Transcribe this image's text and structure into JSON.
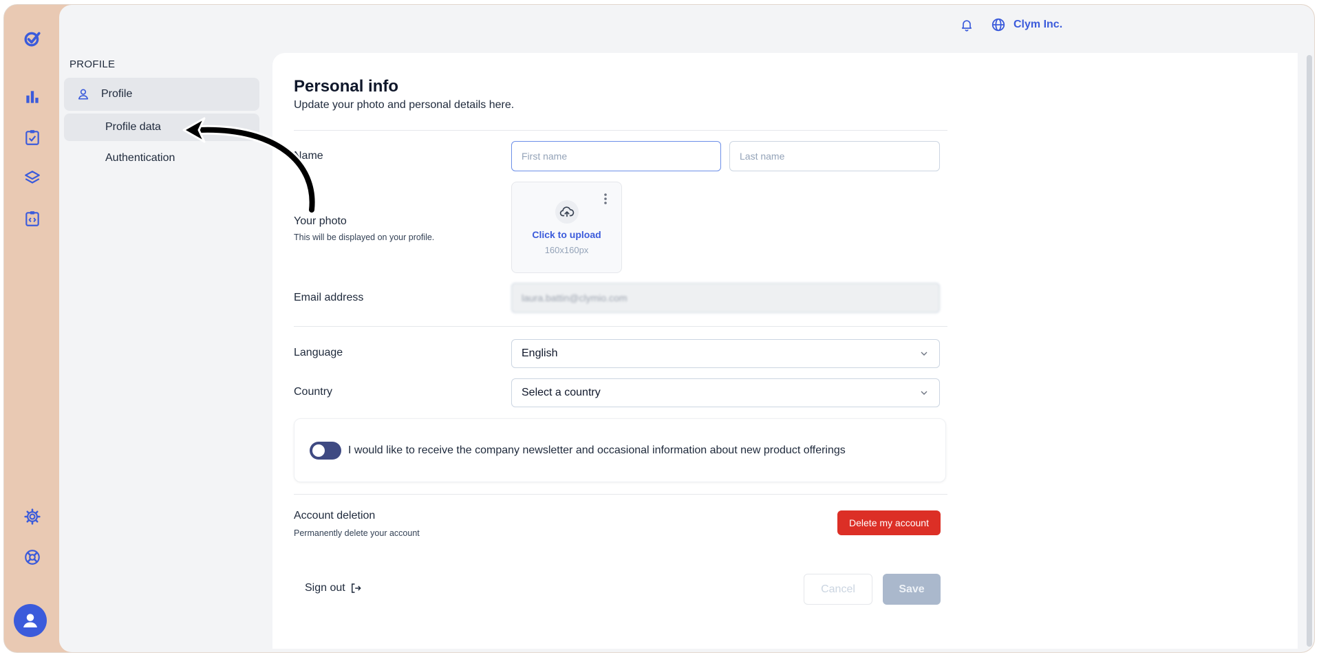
{
  "org": {
    "name": "Clym Inc."
  },
  "colors": {
    "accent": "#3b5bdb",
    "danger": "#dc2f26",
    "rail_bg": "#e9c9b3"
  },
  "rail": {
    "icons": [
      "logo-check-icon",
      "bar-chart-icon",
      "clipboard-check-icon",
      "layers-icon",
      "clipboard-code-icon",
      "gear-icon",
      "life-buoy-icon",
      "user-avatar-icon"
    ]
  },
  "sidebar": {
    "section_title": "PROFILE",
    "items": [
      {
        "label": "Profile"
      },
      {
        "label": "Profile data"
      },
      {
        "label": "Authentication"
      }
    ]
  },
  "personal_info": {
    "title": "Personal info",
    "subtitle": "Update your photo and personal details here."
  },
  "form": {
    "name_label": "Name",
    "first_name_placeholder": "First name",
    "last_name_placeholder": "Last name",
    "photo_label": "Your photo",
    "photo_hint": "This will be displayed on your profile.",
    "upload_cta": "Click to upload",
    "upload_size": "160x160px",
    "email_label": "Email address",
    "email_value": "laura.battin@clymio.com",
    "language_label": "Language",
    "language_value": "English",
    "country_label": "Country",
    "country_value": "Select a country",
    "newsletter_text": "I would like to receive the company newsletter and occasional information about new product offerings"
  },
  "account_deletion": {
    "title": "Account deletion",
    "subtitle": "Permanently delete your account",
    "button": "Delete my account"
  },
  "footer": {
    "sign_out": "Sign out",
    "cancel": "Cancel",
    "save": "Save"
  }
}
